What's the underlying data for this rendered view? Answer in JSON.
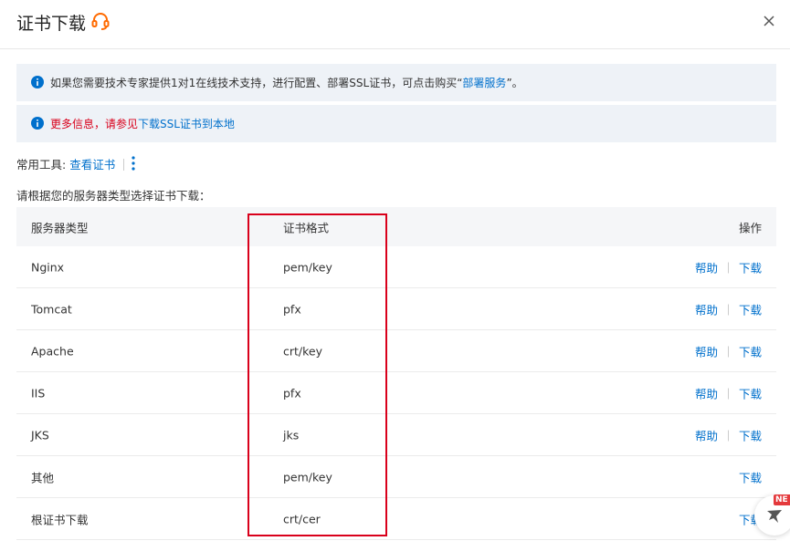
{
  "header": {
    "title": "证书下载",
    "icon": "headset-icon",
    "close_icon": "close-icon"
  },
  "notices": [
    {
      "prefix": "如果您需要技术专家提供1对1在线技术支持，进行配置、部署SSL证书，可点击购买“",
      "link": "部署服务",
      "suffix": "”。"
    },
    {
      "prefix": "更多信息，请参见",
      "link": "下载SSL证书到本地"
    }
  ],
  "tools": {
    "label": "常用工具:",
    "link": "查看证书"
  },
  "instruction": "请根据您的服务器类型选择证书下载：",
  "table": {
    "headers": {
      "type": "服务器类型",
      "format": "证书格式",
      "ops": "操作"
    },
    "rows": [
      {
        "type": "Nginx",
        "format": "pem/key",
        "help": "帮助",
        "download": "下载"
      },
      {
        "type": "Tomcat",
        "format": "pfx",
        "help": "帮助",
        "download": "下载"
      },
      {
        "type": "Apache",
        "format": "crt/key",
        "help": "帮助",
        "download": "下载"
      },
      {
        "type": "IIS",
        "format": "pfx",
        "help": "帮助",
        "download": "下载"
      },
      {
        "type": "JKS",
        "format": "jks",
        "help": "帮助",
        "download": "下载"
      },
      {
        "type": "其他",
        "format": "pem/key",
        "download": "下载"
      },
      {
        "type": "根证书下载",
        "format": "crt/cer",
        "download": "下载"
      }
    ]
  },
  "float": {
    "badge": "NE"
  },
  "colors": {
    "accent": "#0070cc",
    "highlight": "#d9001b",
    "notice_bg": "#eef2f7",
    "icon_orange": "#ff6a00"
  }
}
